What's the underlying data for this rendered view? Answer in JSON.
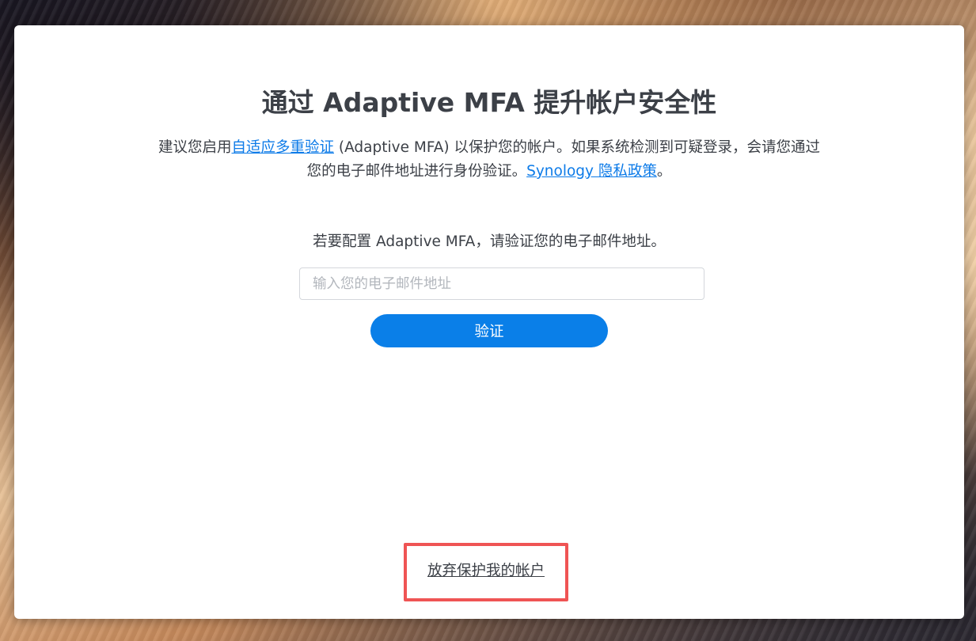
{
  "dialog": {
    "title": "通过 Adaptive MFA 提升帐户安全性",
    "description": {
      "part1": "建议您启用",
      "link_mfa": "自适应多重验证",
      "part2": " (Adaptive MFA) 以保护您的帐户。如果系统检测到可疑登录，会请您通过",
      "part3": "您的电子邮件地址进行身份验证。",
      "link_privacy": "Synology 隐私政策",
      "part4": "。"
    },
    "prompt": "若要配置 Adaptive MFA，请验证您的电子邮件地址。",
    "email_field": {
      "value": "",
      "placeholder": "输入您的电子邮件地址"
    },
    "verify_label": "验证",
    "abandon_label": "放弃保护我的帐户"
  },
  "colors": {
    "accent": "#0a7fe8",
    "link": "#0d7be8",
    "text": "#3c4047",
    "highlight_border": "#ef5454"
  }
}
